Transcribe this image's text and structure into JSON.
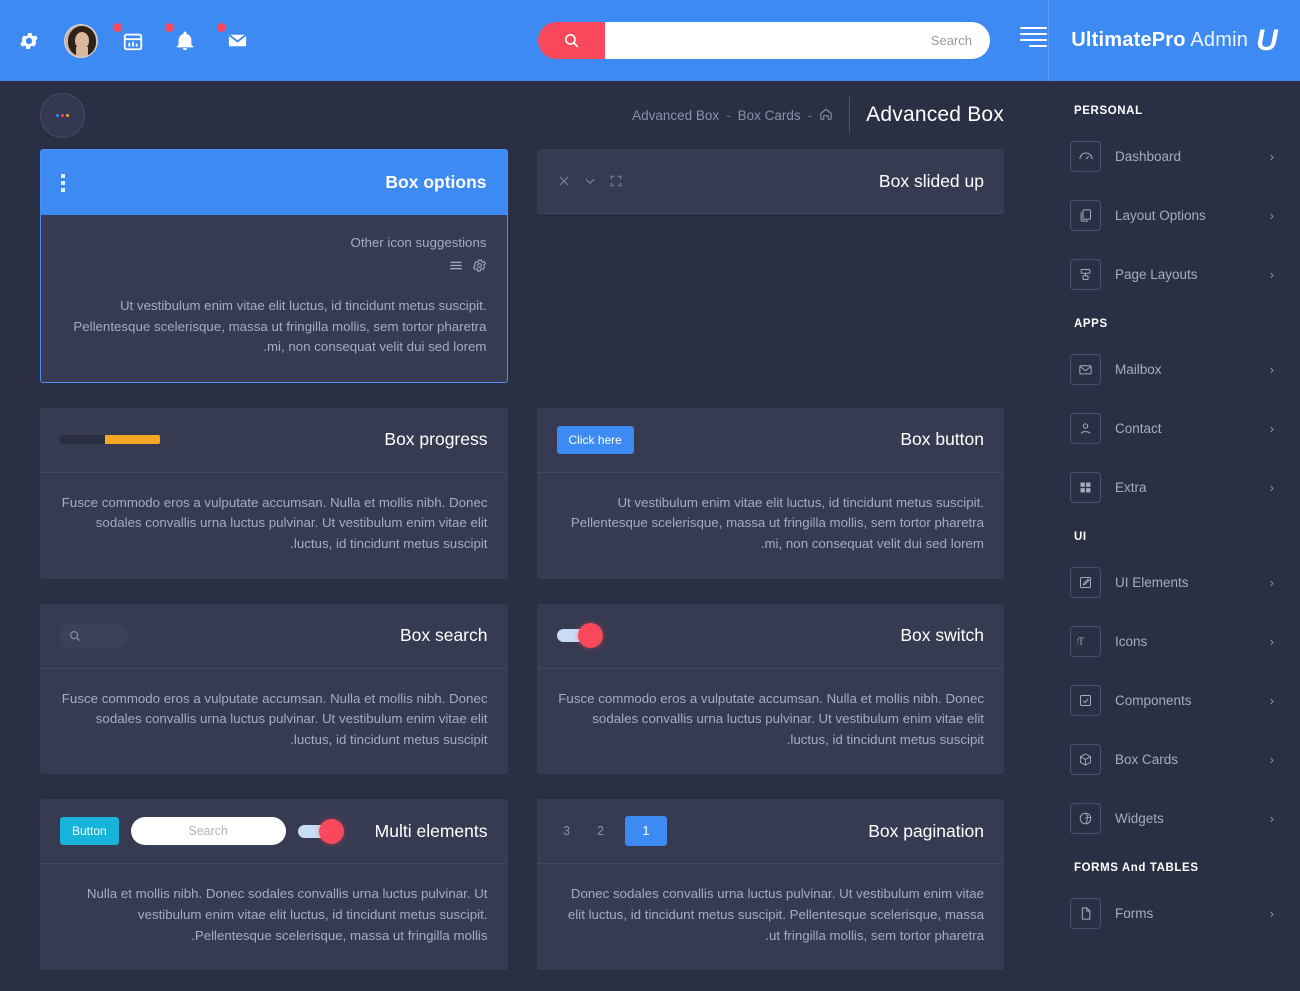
{
  "header": {
    "icons": [
      {
        "name": "gear-icon",
        "badge": false
      },
      {
        "name": "avatar",
        "badge": false
      },
      {
        "name": "calendar-icon",
        "badge": true
      },
      {
        "name": "bell-icon",
        "badge": true
      },
      {
        "name": "mail-icon",
        "badge": true
      }
    ],
    "search": {
      "placeholder": "Search",
      "value": "",
      "button_icon": "search-icon"
    },
    "menu_toggle": "hamburger-icon",
    "brand_bold": "UltimatePro",
    "brand_light": " Admin",
    "brand_logo": "U",
    "accent_blue": "#3d8bf2",
    "accent_red": "#f9485b"
  },
  "breadcrumb": {
    "items": [
      "Advanced Box",
      "Box Cards"
    ],
    "sep": "-",
    "home_icon": "home-icon",
    "dots_button": "more-options-button"
  },
  "page_title": "Advanced Box",
  "cards": [
    {
      "id": "box-options",
      "title": "Box options",
      "header_style": "blue",
      "tools": [
        "vertical-dots-icon"
      ],
      "sub_label": "Other icon suggestions",
      "body_icons": [
        "gear-icon",
        "list-icon"
      ],
      "text": "Ut vestibulum enim vitae elit luctus, id tincidunt metus suscipit. Pellentesque scelerisque, massa ut fringilla mollis, sem tortor pharetra mi, non consequat velit dui sed lorem."
    },
    {
      "id": "box-slided-up",
      "title": "Box slided up",
      "header_style": "plain",
      "tools": [
        "close-icon",
        "chevron-down-icon",
        "expand-icon"
      ],
      "text": ""
    },
    {
      "id": "box-progress",
      "title": "Box progress",
      "header_style": "plain",
      "progress_percent": 55,
      "progress_color": "#f5a623",
      "text": "Fusce commodo eros a vulputate accumsan. Nulla et mollis nibh. Donec sodales convallis urna luctus pulvinar. Ut vestibulum enim vitae elit luctus, id tincidunt metus suscipit."
    },
    {
      "id": "box-button",
      "title": "Box button",
      "header_style": "plain",
      "button_label": "Click here",
      "text": "Ut vestibulum enim vitae elit luctus, id tincidunt metus suscipit. Pellentesque scelerisque, massa ut fringilla mollis, sem tortor pharetra mi, non consequat velit dui sed lorem."
    },
    {
      "id": "box-search",
      "title": "Box search",
      "header_style": "plain",
      "search_placeholder": "",
      "text": "Fusce commodo eros a vulputate accumsan. Nulla et mollis nibh. Donec sodales convallis urna luctus pulvinar. Ut vestibulum enim vitae elit luctus, id tincidunt metus suscipit."
    },
    {
      "id": "box-switch",
      "title": "Box switch",
      "header_style": "plain",
      "switch_on": true,
      "text": "Fusce commodo eros a vulputate accumsan. Nulla et mollis nibh. Donec sodales convallis urna luctus pulvinar. Ut vestibulum enim vitae elit luctus, id tincidunt metus suscipit."
    },
    {
      "id": "multi-elements",
      "title": "Multi elements",
      "header_style": "plain",
      "button_label": "Button",
      "search_placeholder": "Search",
      "switch_on": true,
      "text": "Nulla et mollis nibh. Donec sodales convallis urna luctus pulvinar. Ut vestibulum enim vitae elit luctus, id tincidunt metus suscipit. Pellentesque scelerisque, massa ut fringilla mollis."
    },
    {
      "id": "box-pagination",
      "title": "Box pagination",
      "header_style": "plain",
      "pages": [
        "1",
        "2",
        "3"
      ],
      "active_page": "1",
      "text": "Donec sodales convallis urna luctus pulvinar. Ut vestibulum enim vitae elit luctus, id tincidunt metus suscipit. Pellentesque scelerisque, massa ut fringilla mollis, sem tortor pharetra."
    }
  ],
  "sidebar": {
    "sections": [
      {
        "title": "PERSONAL",
        "items": [
          {
            "label": "Dashboard",
            "icon": "dashboard-icon"
          },
          {
            "label": "Layout Options",
            "icon": "copy-icon"
          },
          {
            "label": "Page Layouts",
            "icon": "layout-icon"
          }
        ]
      },
      {
        "title": "APPS",
        "items": [
          {
            "label": "Mailbox",
            "icon": "mail-icon"
          },
          {
            "label": "Contact",
            "icon": "user-icon"
          },
          {
            "label": "Extra",
            "icon": "grid-icon"
          }
        ]
      },
      {
        "title": "UI",
        "items": [
          {
            "label": "UI Elements",
            "icon": "edit-icon"
          },
          {
            "label": "Icons",
            "icon": "text-size-icon"
          },
          {
            "label": "Components",
            "icon": "checkbox-icon"
          },
          {
            "label": "Box Cards",
            "icon": "box-icon"
          },
          {
            "label": "Widgets",
            "icon": "widget-icon"
          }
        ]
      },
      {
        "title": "FORMS And TABLES",
        "items": [
          {
            "label": "Forms",
            "icon": "file-icon"
          }
        ]
      }
    ],
    "chevron": "‹"
  }
}
